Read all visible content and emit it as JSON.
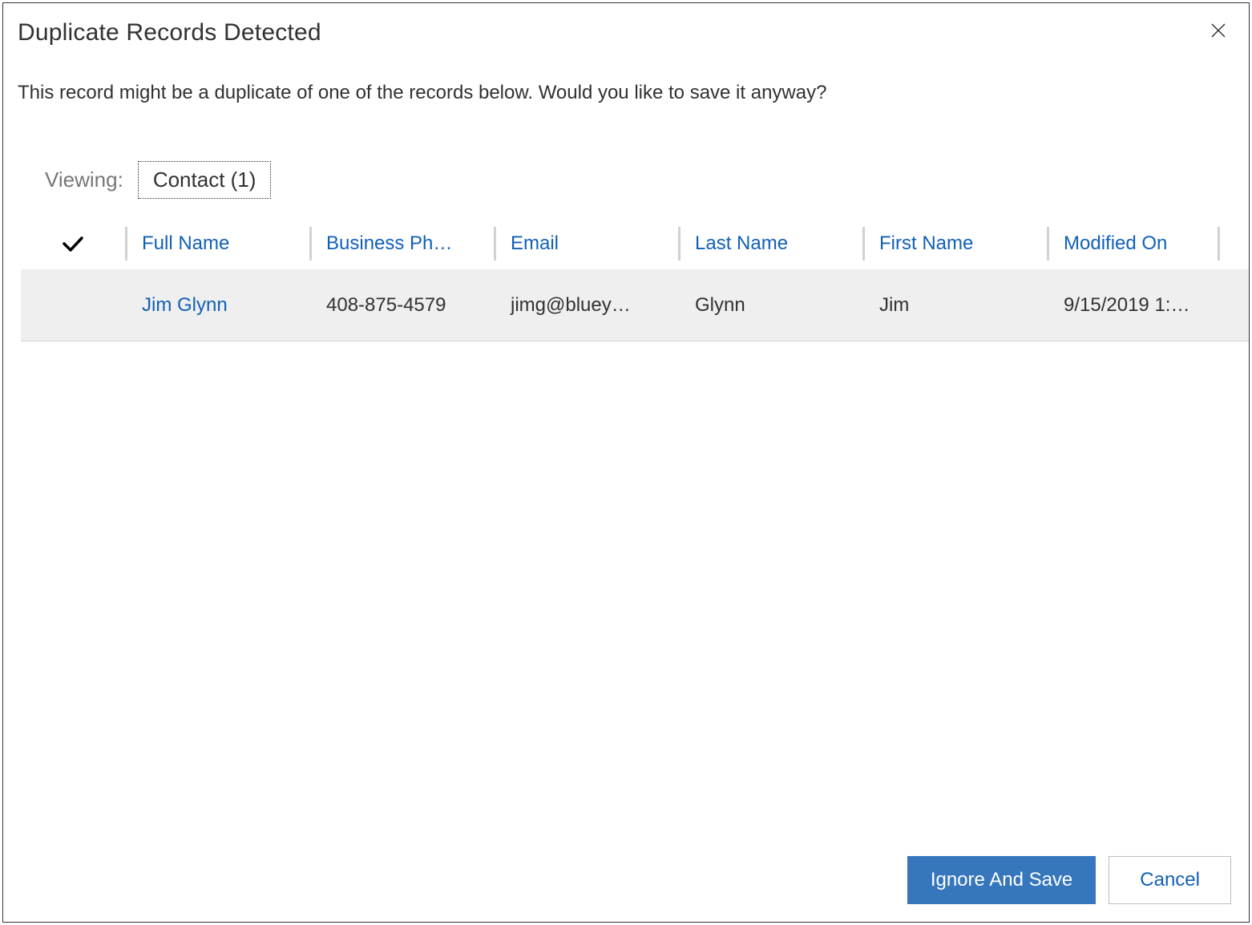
{
  "dialog": {
    "title": "Duplicate Records Detected",
    "message": "This record might be a duplicate of one of the records below. Would you like to save it anyway?"
  },
  "viewing": {
    "label": "Viewing:",
    "tab": "Contact (1)"
  },
  "grid": {
    "headers": {
      "full_name": "Full Name",
      "business_phone": "Business Ph…",
      "email": "Email",
      "last_name": "Last Name",
      "first_name": "First Name",
      "modified_on": "Modified On"
    },
    "rows": [
      {
        "full_name": "Jim Glynn",
        "business_phone": "408-875-4579",
        "email": "jimg@bluey…",
        "last_name": "Glynn",
        "first_name": "Jim",
        "modified_on": "9/15/2019 1:…"
      }
    ]
  },
  "footer": {
    "primary": "Ignore And Save",
    "secondary": "Cancel"
  }
}
